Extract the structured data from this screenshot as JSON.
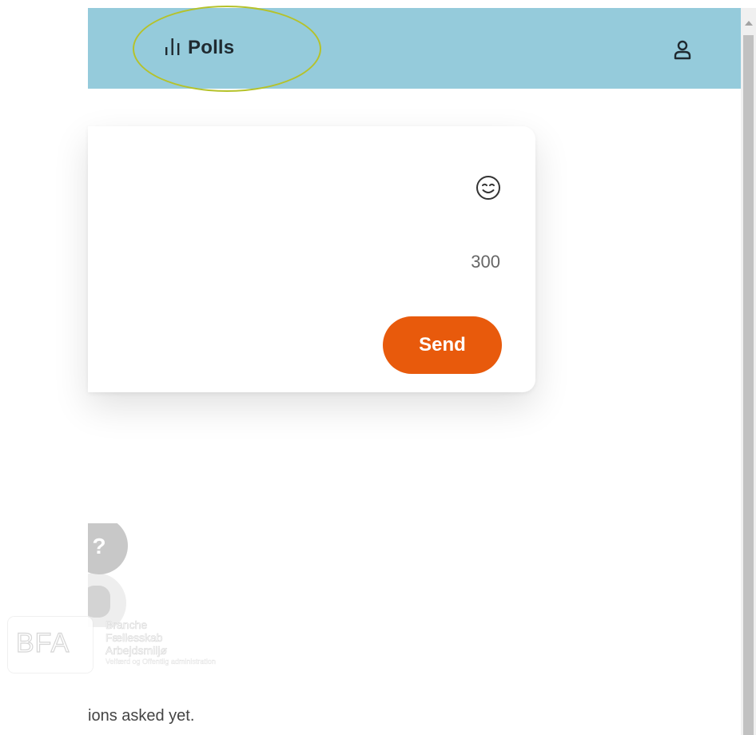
{
  "header": {
    "polls_label": "Polls",
    "background_color": "#95cbdb",
    "polls_icon": "bar-chart-icon",
    "user_icon": "user-icon"
  },
  "composer": {
    "emoji_icon": "smile-icon",
    "char_counter": "300",
    "send_label": "Send",
    "send_color": "#e85a0c"
  },
  "empty_state": {
    "icon": "question-bubble-icon",
    "text": "ions asked yet."
  },
  "watermark": {
    "letters": "BFA",
    "line1": "Branche",
    "line2": "Fællesskab",
    "line3": "Arbejdsmiljø",
    "line4": "Velfærd og Offentlig administration"
  },
  "annotation": {
    "highlight_color": "#b5c22a"
  }
}
